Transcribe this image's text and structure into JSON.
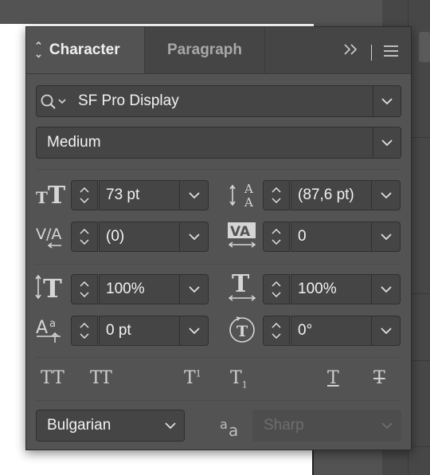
{
  "tabs": {
    "character": "Character",
    "paragraph": "Paragraph"
  },
  "header_icons": [
    "expand-icon",
    "panel-menu-icon"
  ],
  "font": {
    "family": "SF Pro Display",
    "style": "Medium"
  },
  "size": "73 pt",
  "leading": "(87,6 pt)",
  "kerning": "(0)",
  "tracking": "0",
  "vertical_scale": "100%",
  "horizontal_scale": "100%",
  "baseline_shift": "0 pt",
  "rotation": "0°",
  "type_buttons": {
    "all_caps": "TT",
    "small_caps": "TT",
    "superscript": "T",
    "subscript": "T",
    "underline": "T",
    "strikethrough": "T"
  },
  "language": "Bulgarian",
  "antialias": "Sharp",
  "colors": {
    "panel": "#535353",
    "field": "#454545",
    "text": "#f2f2f2",
    "disabled": "#6e6e6e"
  }
}
